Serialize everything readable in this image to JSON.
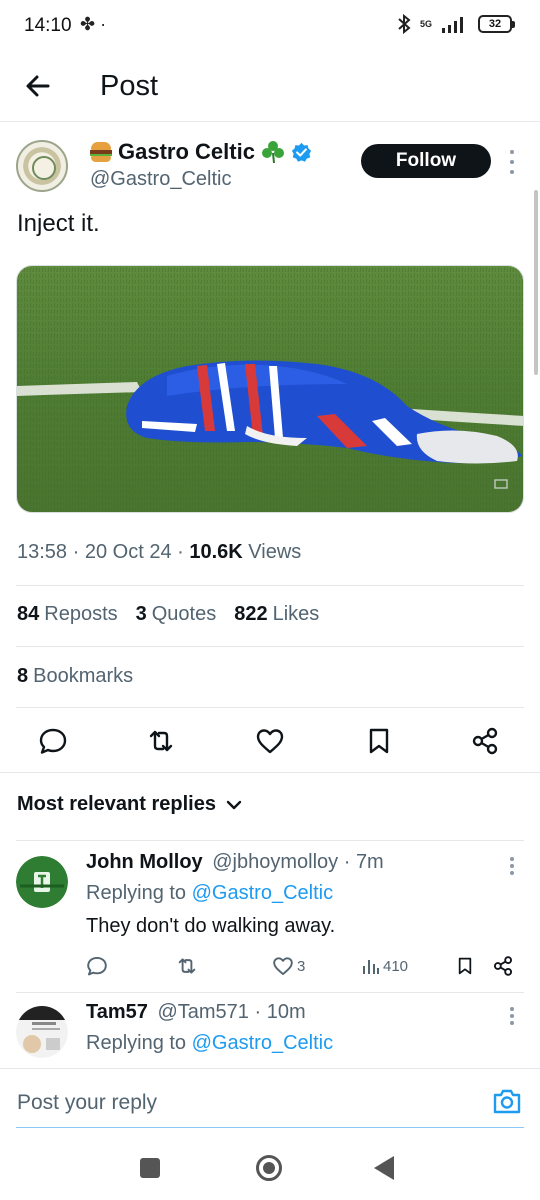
{
  "status_bar": {
    "time": "14:10",
    "network": "5G",
    "battery": "32"
  },
  "header": {
    "title": "Post"
  },
  "post": {
    "author_name": "Gastro Celtic",
    "author_handle": "@Gastro_Celtic",
    "follow_label": "Follow",
    "text": "Inject it.",
    "time": "13:58",
    "date": "20 Oct 24",
    "views_count": "10.6K",
    "views_label": "Views",
    "reposts_count": "84",
    "reposts_label": "Reposts",
    "quotes_count": "3",
    "quotes_label": "Quotes",
    "likes_count": "822",
    "likes_label": "Likes",
    "bookmarks_count": "8",
    "bookmarks_label": "Bookmarks",
    "verified_color": "#1d9bf0"
  },
  "replies": {
    "sort_label": "Most relevant replies",
    "items": [
      {
        "name": "John Molloy",
        "handle": "@jbhoymolloy",
        "age": "7m",
        "replying_prefix": "Replying to",
        "replying_to": "@Gastro_Celtic",
        "text": "They don't do walking away.",
        "likes": "3",
        "views": "410"
      },
      {
        "name": "Tam57",
        "handle": "@Tam571",
        "age": "10m",
        "replying_prefix": "Replying to",
        "replying_to": "@Gastro_Celtic"
      }
    ]
  },
  "reply_composer": {
    "placeholder": "Post your reply"
  },
  "colors": {
    "accent": "#1d9bf0",
    "text_primary": "#0f1419",
    "text_secondary": "#536471"
  }
}
